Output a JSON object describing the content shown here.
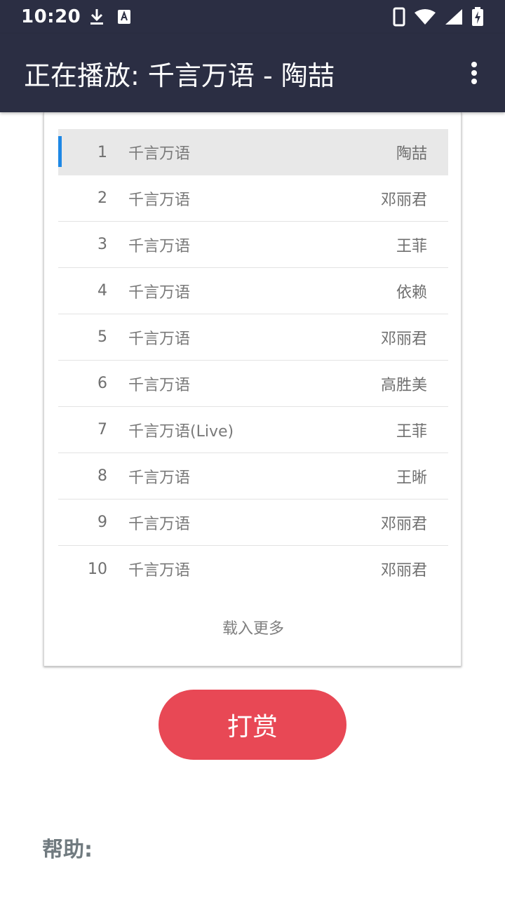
{
  "status_bar": {
    "time": "10:20",
    "icons": [
      "download-icon",
      "keyboard-icon",
      "phone-icon",
      "wifi-icon",
      "signal-icon",
      "battery-charging-icon"
    ]
  },
  "app_bar": {
    "title": "正在播放: 千言万语 - 陶喆",
    "menu_icon": "more-vert-icon"
  },
  "playlist": {
    "active_index": 0,
    "songs": [
      {
        "num": "1",
        "title": "千言万语",
        "artist": "陶喆"
      },
      {
        "num": "2",
        "title": "千言万语",
        "artist": "邓丽君"
      },
      {
        "num": "3",
        "title": "千言万语",
        "artist": "王菲"
      },
      {
        "num": "4",
        "title": "千言万语",
        "artist": "依赖"
      },
      {
        "num": "5",
        "title": "千言万语",
        "artist": "邓丽君"
      },
      {
        "num": "6",
        "title": "千言万语",
        "artist": "高胜美"
      },
      {
        "num": "7",
        "title": "千言万语(Live)",
        "artist": "王菲"
      },
      {
        "num": "8",
        "title": "千言万语",
        "artist": "王晰"
      },
      {
        "num": "9",
        "title": "千言万语",
        "artist": "邓丽君"
      },
      {
        "num": "10",
        "title": "千言万语",
        "artist": "邓丽君"
      }
    ],
    "load_more": "载入更多"
  },
  "donate_label": "打赏",
  "help": {
    "heading": "帮助:"
  },
  "colors": {
    "app_bar": "#2b2e43",
    "accent_marker": "#1e88e5",
    "donate": "#e84855"
  }
}
